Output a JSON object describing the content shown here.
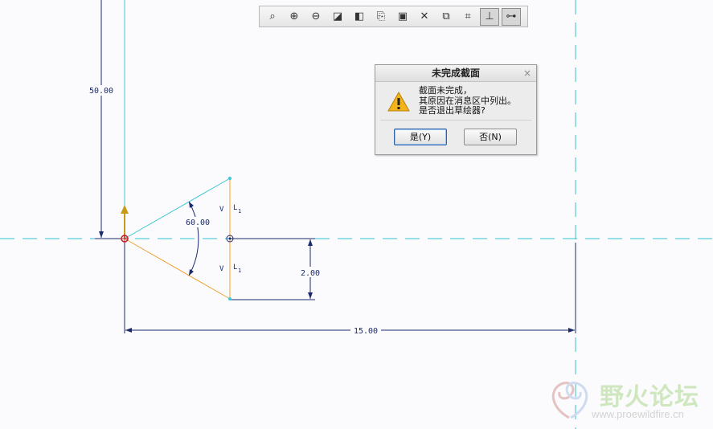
{
  "toolbar": {
    "buttons": [
      {
        "name": "zoom-fit",
        "glyph": "⌕",
        "active": false
      },
      {
        "name": "zoom-in",
        "glyph": "⊕",
        "active": false
      },
      {
        "name": "zoom-out",
        "glyph": "⊖",
        "active": false
      },
      {
        "name": "repaint",
        "glyph": "◪",
        "active": false
      },
      {
        "name": "display-style",
        "glyph": "◧",
        "active": false
      },
      {
        "name": "saved-views",
        "glyph": "⎘",
        "active": false
      },
      {
        "name": "sketch-view",
        "glyph": "▣",
        "active": false
      },
      {
        "name": "dim-display",
        "glyph": "✕",
        "active": false
      },
      {
        "name": "constraint-display",
        "glyph": "⧉",
        "active": false
      },
      {
        "name": "grid-display",
        "glyph": "⌗",
        "active": false
      },
      {
        "name": "vertex-display",
        "glyph": "⊥",
        "active": true
      },
      {
        "name": "sketch-diagnostic",
        "glyph": "⊶",
        "active": true
      }
    ]
  },
  "sketch": {
    "dimensions": {
      "vertical": "50.00",
      "angle": "60.00",
      "offset": "2.00",
      "horizontal": "15.00"
    },
    "constraints": {
      "vertical_1": "V",
      "vertical_2": "V",
      "equal_1": "L",
      "equal_1_sub": "1",
      "equal_2": "L",
      "equal_2_sub": "1"
    },
    "colors": {
      "centerline": "#2ec4cf",
      "dimension": "#1b2a6b",
      "sketch_orange": "#f0a030",
      "sketch_cyan": "#3cc8d4",
      "origin": "#c0202a",
      "arrow_gold": "#c89a1a"
    }
  },
  "dialog": {
    "title": "未完成截面",
    "close": "×",
    "icon": "warning-icon",
    "message_lines": [
      "截面未完成，",
      "其原因在消息区中列出。",
      "是否退出草绘器?"
    ],
    "yes_label": "是(Y)",
    "no_label": "否(N)"
  },
  "watermark": {
    "name": "野火论坛",
    "url": "www.proewildfire.cn"
  }
}
